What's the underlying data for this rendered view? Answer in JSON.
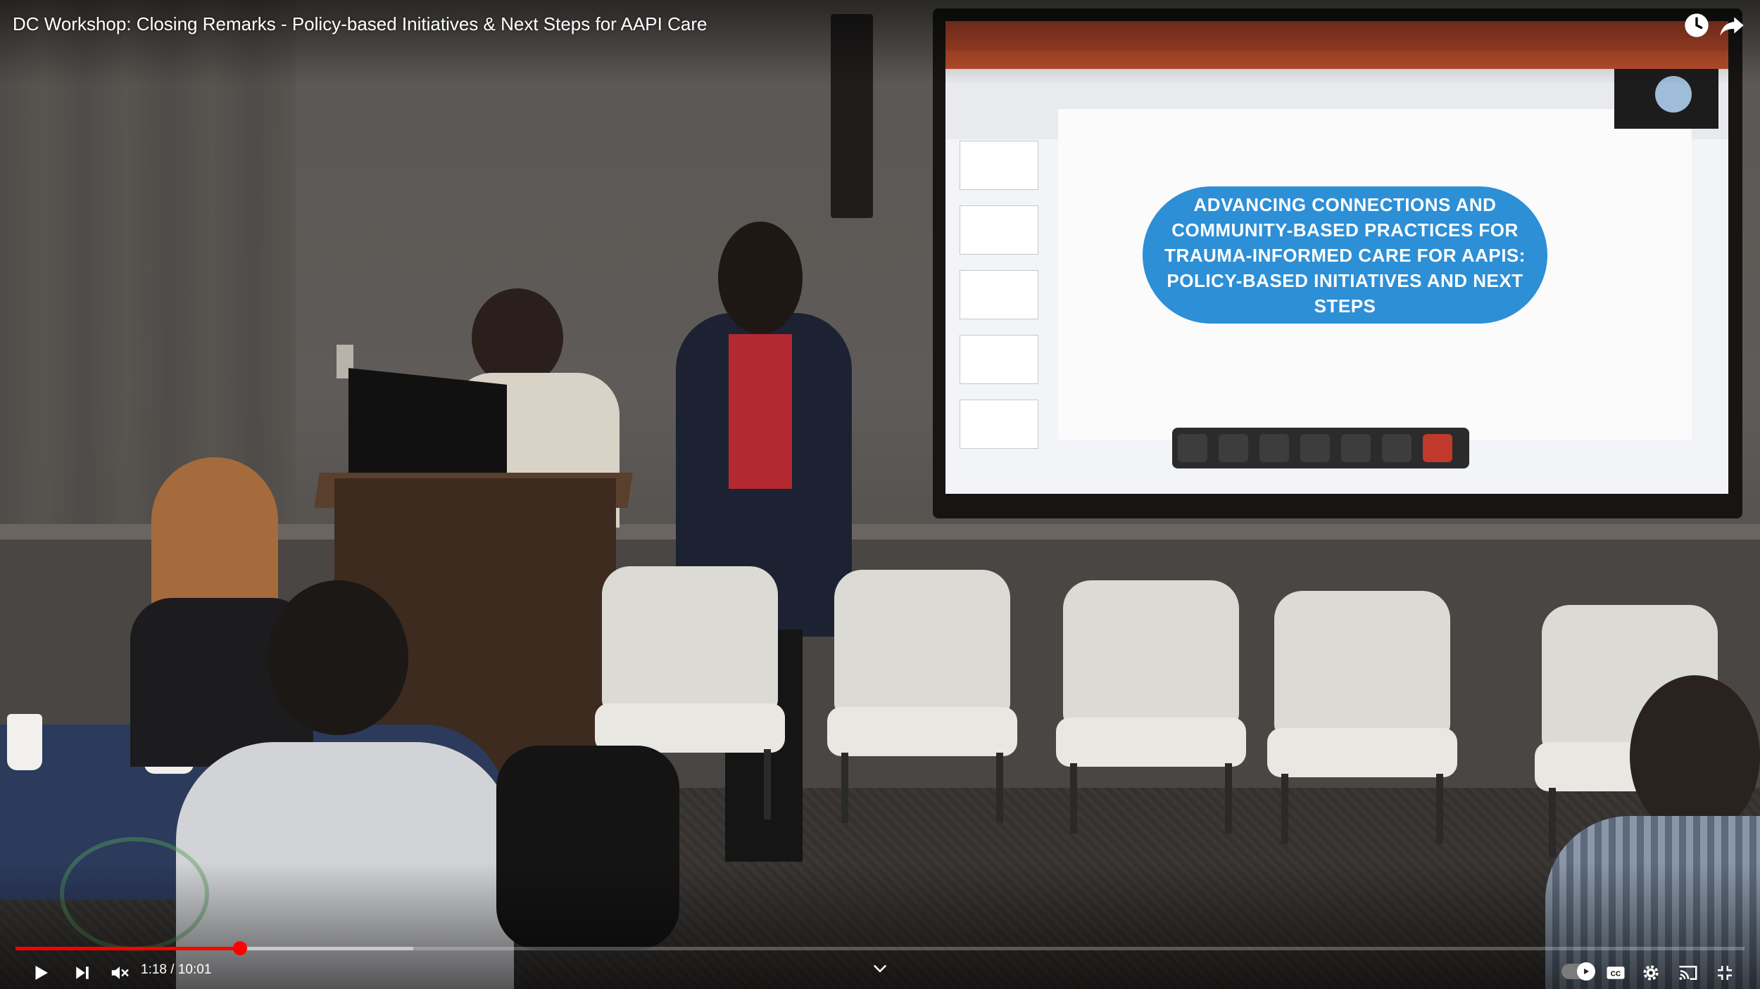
{
  "player": {
    "title": "DC Workshop: Closing Remarks - Policy-based Initiatives & Next Steps for AAPI Care",
    "time_current": "1:18",
    "time_total": "10:01",
    "time_display": "1:18 / 10:01",
    "progress_fraction": 0.13,
    "buffered_fraction": 0.1,
    "muted": true,
    "accent_color": "#ff0000",
    "autoplay_enabled": true
  },
  "icons": {
    "play": "play-icon",
    "next": "next-icon",
    "volume": "volume-muted-icon",
    "watch_later": "clock-icon",
    "share": "share-icon",
    "captions": "captions-icon",
    "settings": "gear-icon",
    "cast": "cast-icon",
    "fullscreen": "exit-fullscreen-icon",
    "chevron": "chevron-down-icon",
    "autoplay": "autoplay-toggle-icon"
  },
  "slide": {
    "title": "ADVANCING CONNECTIONS AND\nCOMMUNITY-BASED PRACTICES FOR\nTRAUMA-INFORMED CARE FOR AAPIs:\nPolicy-based Initiatives and Next Steps",
    "pill_color": "#2d8fd6"
  }
}
